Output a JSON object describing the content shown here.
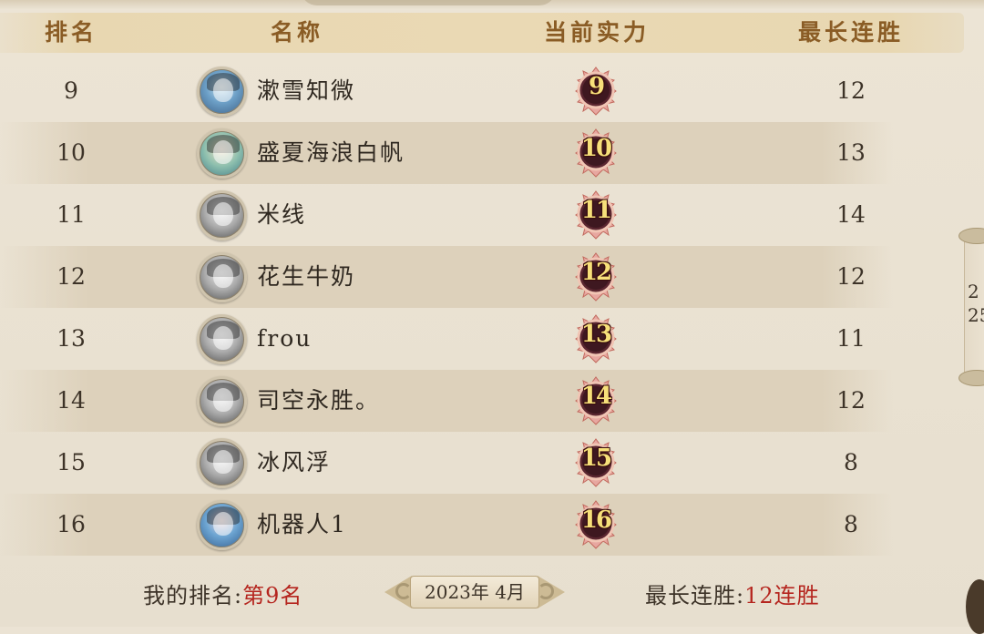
{
  "header": {
    "rank": "排名",
    "name": "名称",
    "power": "当前实力",
    "streak": "最长连胜"
  },
  "rows": [
    {
      "rank": "9",
      "name": "漱雪知微",
      "power": "9",
      "streak": "12",
      "avatar": "color"
    },
    {
      "rank": "10",
      "name": "盛夏海浪白帆",
      "power": "10",
      "streak": "13",
      "avatar": "color2"
    },
    {
      "rank": "11",
      "name": "米线",
      "power": "11",
      "streak": "14",
      "avatar": "gray"
    },
    {
      "rank": "12",
      "name": "花生牛奶",
      "power": "12",
      "streak": "12",
      "avatar": "gray"
    },
    {
      "rank": "13",
      "name": "frou",
      "power": "13",
      "streak": "11",
      "avatar": "gray"
    },
    {
      "rank": "14",
      "name": "司空永胜。",
      "power": "14",
      "streak": "12",
      "avatar": "gray"
    },
    {
      "rank": "15",
      "name": "冰风浮",
      "power": "15",
      "streak": "8",
      "avatar": "gray"
    },
    {
      "rank": "16",
      "name": "机器人1",
      "power": "16",
      "streak": "8",
      "avatar": "color3"
    }
  ],
  "footer": {
    "my_rank_label": "我的排名:",
    "my_rank_value": "第9名",
    "month": "2023年 4月",
    "best_label": "最长连胜:",
    "best_value": "12连胜"
  },
  "pager": {
    "current": "2",
    "total": "25"
  },
  "colors": {
    "background": "#ebe3d4",
    "header_text": "#8a5c25",
    "highlight_red": "#b5261f",
    "badge_text": "#f7e07a"
  }
}
